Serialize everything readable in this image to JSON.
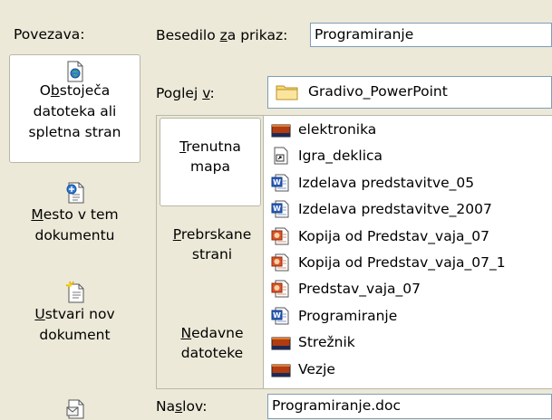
{
  "left_bar": {
    "header": "Povezava:",
    "items": [
      {
        "pre": "O",
        "ul": "b",
        "post": "stoječa",
        "line2": "datoteka ali",
        "line3": "spletna stran"
      },
      {
        "pre": "",
        "ul": "M",
        "post": "esto v tem",
        "line2": "dokumentu"
      },
      {
        "pre": "",
        "ul": "U",
        "post": "stvari nov",
        "line2": "dokument"
      }
    ]
  },
  "display_text": {
    "label_pre": "Besedilo ",
    "label_ul": "z",
    "label_post": "a prikaz:",
    "value": "Programiranje"
  },
  "look_in": {
    "label_pre": "Poglej ",
    "label_ul": "v",
    "label_post": ":",
    "value": "Gradivo_PowerPoint"
  },
  "tabs": [
    {
      "ul": "T",
      "post": "renutna",
      "line2": "mapa"
    },
    {
      "ul": "P",
      "post": "rebrskane",
      "line2": "strani"
    },
    {
      "ul": "N",
      "post": "edavne",
      "line2": "datoteke"
    }
  ],
  "files": [
    {
      "name": "elektronika",
      "icon": "folder-dark-icon"
    },
    {
      "name": "Igra_deklica",
      "icon": "shortcut-icon"
    },
    {
      "name": "Izdelava predstavitve_05",
      "icon": "word-doc-icon"
    },
    {
      "name": "Izdelava predstavitve_2007",
      "icon": "word-doc-icon"
    },
    {
      "name": "Kopija od Predstav_vaja_07",
      "icon": "powerpoint-icon"
    },
    {
      "name": "Kopija od Predstav_vaja_07_1",
      "icon": "powerpoint-icon"
    },
    {
      "name": "Predstav_vaja_07",
      "icon": "powerpoint-icon"
    },
    {
      "name": "Programiranje",
      "icon": "word-doc-icon"
    },
    {
      "name": "Strežnik",
      "icon": "folder-dark-icon"
    },
    {
      "name": "Vezje",
      "icon": "folder-dark-icon"
    }
  ],
  "address": {
    "label_pre": "Na",
    "label_ul": "s",
    "label_post": "lov:",
    "value": "Programiranje.doc"
  }
}
